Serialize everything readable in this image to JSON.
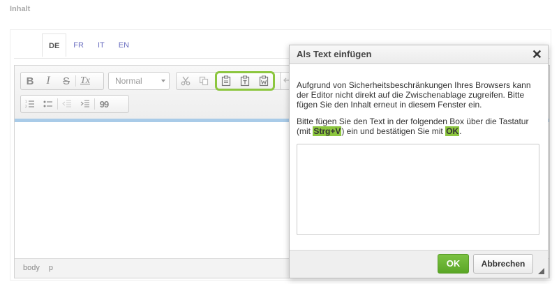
{
  "section_label": "Inhalt",
  "language_tabs": [
    {
      "label": "DE",
      "active": true
    },
    {
      "label": "FR",
      "active": false
    },
    {
      "label": "IT",
      "active": false
    },
    {
      "label": "EN",
      "active": false
    }
  ],
  "toolbar": {
    "bold": "B",
    "italic": "I",
    "strike": "S",
    "remove_format": "Tx",
    "format_value": "Normal",
    "blockquote": "99"
  },
  "status_path": [
    "body",
    "p"
  ],
  "dialog": {
    "title": "Als Text einfügen",
    "close": "✕",
    "para1": "Aufgrund von Sicherheitsbeschränkungen Ihres Browsers kann der Editor nicht direkt auf die Zwischenablage zugreifen. Bitte fügen Sie den Inhalt erneut in diesem Fenster ein.",
    "para2_a": "Bitte fügen Sie den Text in der folgenden Box über die Tastatur (mit ",
    "para2_key": "Strg+V",
    "para2_b": ") ein und bestätigen Sie mit ",
    "para2_ok": "OK",
    "para2_c": ".",
    "textarea_value": "",
    "ok_label": "OK",
    "cancel_label": "Abbrechen"
  },
  "colors": {
    "accent_green": "#8cc63f",
    "ok_green": "#5aa626",
    "tab_blue": "#6a6ec0"
  }
}
